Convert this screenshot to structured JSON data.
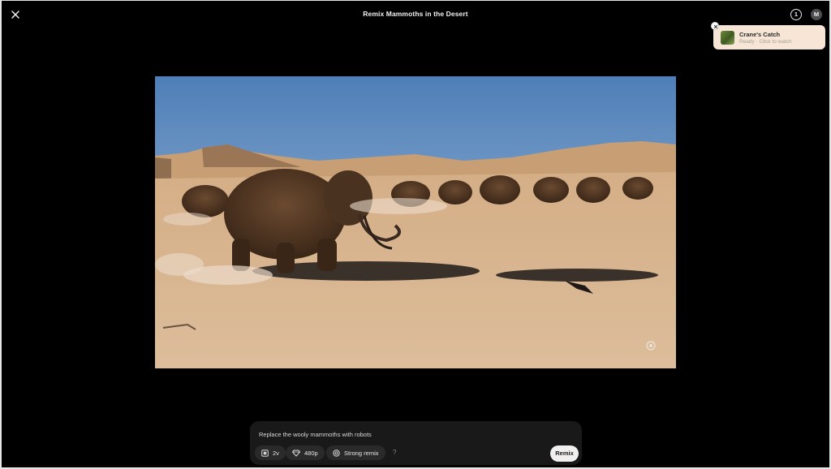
{
  "header": {
    "title": "Remix Mammoths in the Desert",
    "notification_count": "1",
    "avatar_initial": "M"
  },
  "toast": {
    "title": "Crane's Catch",
    "subtitle": "Ready · Click to watch"
  },
  "prompt": {
    "value": "Replace the wooly mammoths with robots"
  },
  "options": {
    "variations": "2v",
    "resolution": "480p",
    "strength": "Strong remix",
    "help": "?"
  },
  "actions": {
    "remix_label": "Remix"
  },
  "colors": {
    "background": "#000000",
    "panel": "#1a1919",
    "toast": "#f7e6d6",
    "sand": "#d9b792",
    "sky": "#5f8fc4"
  }
}
